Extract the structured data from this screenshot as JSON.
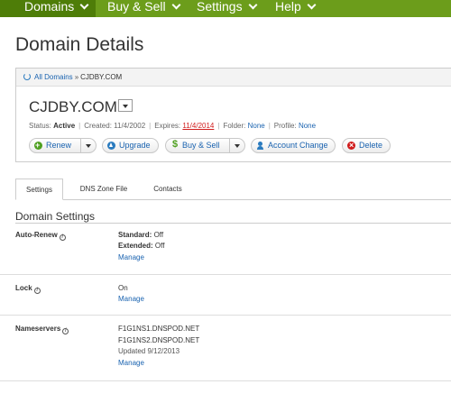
{
  "nav": {
    "items": [
      {
        "label": "Domains"
      },
      {
        "label": "Buy & Sell"
      },
      {
        "label": "Settings"
      },
      {
        "label": "Help"
      }
    ]
  },
  "page": {
    "title": "Domain Details"
  },
  "breadcrumb": {
    "link": "All Domains",
    "separator": "»",
    "current": "CJDBY.COM"
  },
  "domain": {
    "name": "CJDBY.COM",
    "status_label": "Status:",
    "status_value": "Active",
    "created_label": "Created:",
    "created_value": "11/4/2002",
    "expires_label": "Expires:",
    "expires_value": "11/4/2014",
    "folder_label": "Folder:",
    "folder_value": "None",
    "profile_label": "Profile:",
    "profile_value": "None"
  },
  "actions": {
    "renew": "Renew",
    "upgrade": "Upgrade",
    "buy_sell": "Buy & Sell",
    "account_change": "Account Change",
    "delete": "Delete"
  },
  "tabs": [
    {
      "label": "Settings"
    },
    {
      "label": "DNS Zone File"
    },
    {
      "label": "Contacts"
    }
  ],
  "settings": {
    "section_title": "Domain Settings",
    "auto_renew": {
      "label": "Auto-Renew",
      "standard_label": "Standard:",
      "standard_value": "Off",
      "extended_label": "Extended:",
      "extended_value": "Off",
      "manage": "Manage"
    },
    "lock": {
      "label": "Lock",
      "value": "On",
      "manage": "Manage"
    },
    "nameservers": {
      "label": "Nameservers",
      "ns1": "F1G1NS1.DNSPOD.NET",
      "ns2": "F1G1NS2.DNSPOD.NET",
      "updated": "Updated 9/12/2013",
      "manage": "Manage"
    }
  },
  "colors": {
    "nav_bg": "#6c9d1b",
    "nav_active": "#4e7d08",
    "link": "#1a63b0",
    "expired": "#d01c1c"
  }
}
